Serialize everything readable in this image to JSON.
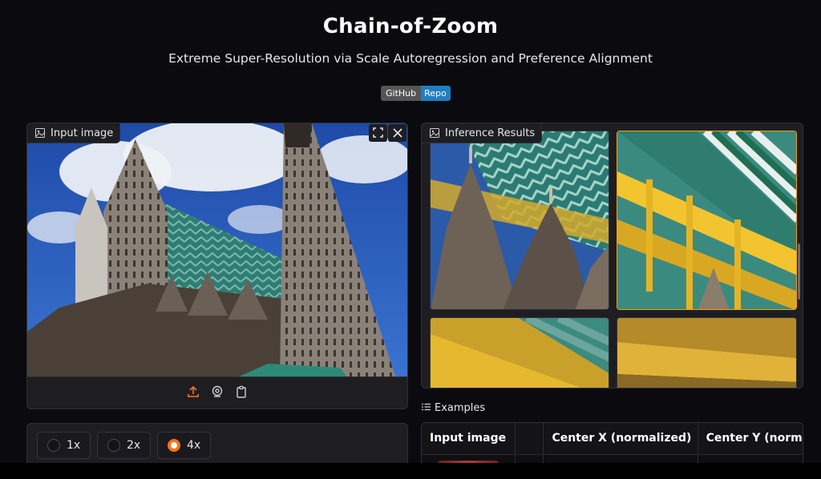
{
  "header": {
    "title": "Chain-of-Zoom",
    "subtitle": "Extreme Super-Resolution via Scale Autoregression and Preference Alignment",
    "badge_left": "GitHub",
    "badge_right": "Repo"
  },
  "input_panel": {
    "label": "Input image",
    "icons": [
      "image-icon",
      "fullscreen-icon",
      "close-icon",
      "upload-icon",
      "webcam-icon",
      "clipboard-icon"
    ]
  },
  "scale_options": {
    "options": [
      "1x",
      "2x",
      "4x"
    ],
    "selected": "4x"
  },
  "results_panel": {
    "label": "Inference Results"
  },
  "examples": {
    "label": "Examples",
    "columns": [
      "Input image",
      "",
      "Center X (normalized)",
      "Center Y (norm"
    ]
  },
  "colors": {
    "background": "#0b0b0f",
    "panel": "#1e1e22",
    "accent": "#f97316",
    "badge_blue": "#1f7fc2",
    "badge_gray": "#555555"
  }
}
